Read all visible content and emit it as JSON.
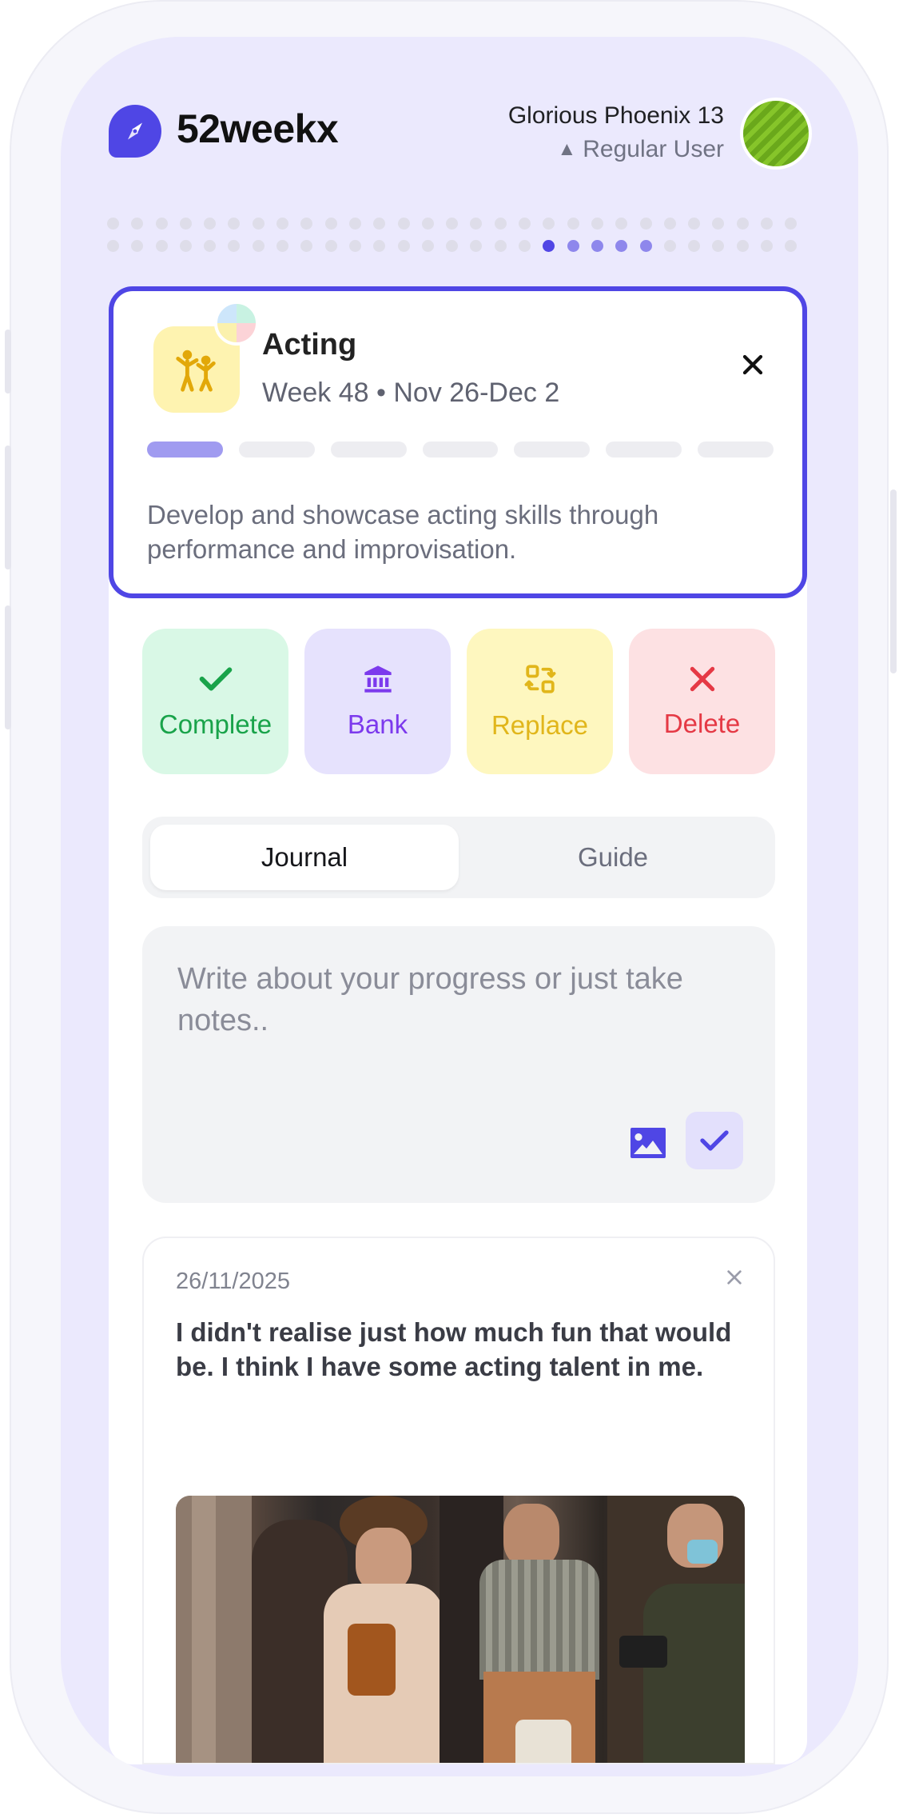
{
  "app": {
    "brand": "52weekx",
    "user_name": "Glorious Phoenix 13",
    "user_role": "Regular User",
    "accent_color": "#4f46e5"
  },
  "weeks_track": {
    "total": 58,
    "completed_range": [
      48,
      52
    ],
    "current": 48
  },
  "goal": {
    "icon": "people-acting-icon",
    "title": "Acting",
    "week_label": "Week 48 • Nov 26-Dec 2",
    "description": "Develop and showcase acting skills through performance and improvisation.",
    "progress_segments": 7,
    "progress_filled": 1
  },
  "actions": [
    {
      "label": "Complete",
      "icon": "check-icon",
      "color": "#19a34a"
    },
    {
      "label": "Bank",
      "icon": "bank-icon",
      "color": "#7c3aed"
    },
    {
      "label": "Replace",
      "icon": "swap-icon",
      "color": "#e1b61b"
    },
    {
      "label": "Delete",
      "icon": "x-icon",
      "color": "#e53945"
    }
  ],
  "tabs": [
    {
      "label": "Journal",
      "active": true
    },
    {
      "label": "Guide",
      "active": false
    }
  ],
  "journal": {
    "placeholder": "Write about your progress or just take notes.."
  },
  "entries": [
    {
      "date": "26/11/2025",
      "text": "I didn't realise just how much fun that would be. I think I have some acting talent in me.",
      "photo": "group-of-actors-photo"
    }
  ]
}
